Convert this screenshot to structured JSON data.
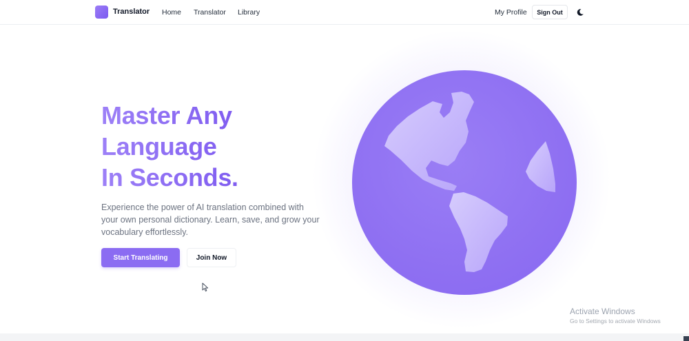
{
  "nav": {
    "brand": "Translator",
    "links": [
      "Home",
      "Translator",
      "Library"
    ],
    "profile": "My Profile",
    "sign_out": "Sign Out"
  },
  "hero": {
    "headline": [
      "Master Any",
      "Language",
      "In Seconds."
    ],
    "subtext": "Experience the power of AI translation combined with your own personal dictionary. Learn, save, and grow your vocabulary effortlessly.",
    "primary_cta": "Start Translating",
    "secondary_cta": "Join Now"
  },
  "watermark": {
    "title": "Activate Windows",
    "subtitle": "Go to Settings to activate Windows"
  },
  "colors": {
    "accent": "#8b6cf2",
    "globe": "#9173f3",
    "continents": "#c4b5fb"
  },
  "icons": {
    "logo": "logo-icon",
    "theme": "moon-icon",
    "globe": "globe-icon",
    "cursor": "mouse-cursor-icon"
  }
}
